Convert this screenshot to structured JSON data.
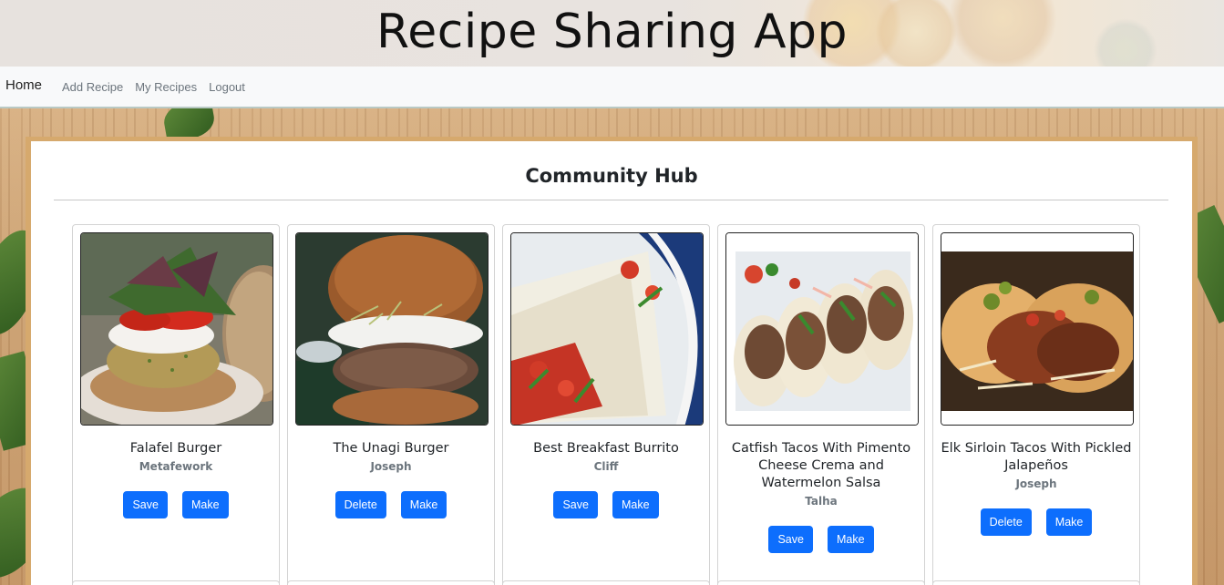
{
  "app": {
    "title": "Recipe Sharing App"
  },
  "nav": {
    "brand": "Home",
    "links": [
      "Add Recipe",
      "My Recipes",
      "Logout"
    ]
  },
  "hub": {
    "title": "Community Hub"
  },
  "recipes": [
    {
      "title": "Falafel Burger",
      "author": "Metafework",
      "buttons": [
        "Save",
        "Make"
      ],
      "image": "falafel-burger-photo"
    },
    {
      "title": "The Unagi Burger",
      "author": "Joseph",
      "buttons": [
        "Delete",
        "Make"
      ],
      "image": "unagi-burger-photo"
    },
    {
      "title": "Best Breakfast Burrito",
      "author": "Cliff",
      "buttons": [
        "Save",
        "Make"
      ],
      "image": "breakfast-burrito-photo"
    },
    {
      "title": "Catfish Tacos With Pimento Cheese Crema and Watermelon Salsa",
      "author": "Talha",
      "buttons": [
        "Save",
        "Make"
      ],
      "image": "catfish-tacos-photo"
    },
    {
      "title": "Elk Sirloin Tacos With Pickled Jalapeños",
      "author": "Joseph",
      "buttons": [
        "Delete",
        "Make"
      ],
      "image": "elk-tacos-photo"
    }
  ],
  "colors": {
    "primary_button": "#0d6efd",
    "navbar_bg": "#f8f9fa",
    "panel_border": "#d6a96d"
  }
}
